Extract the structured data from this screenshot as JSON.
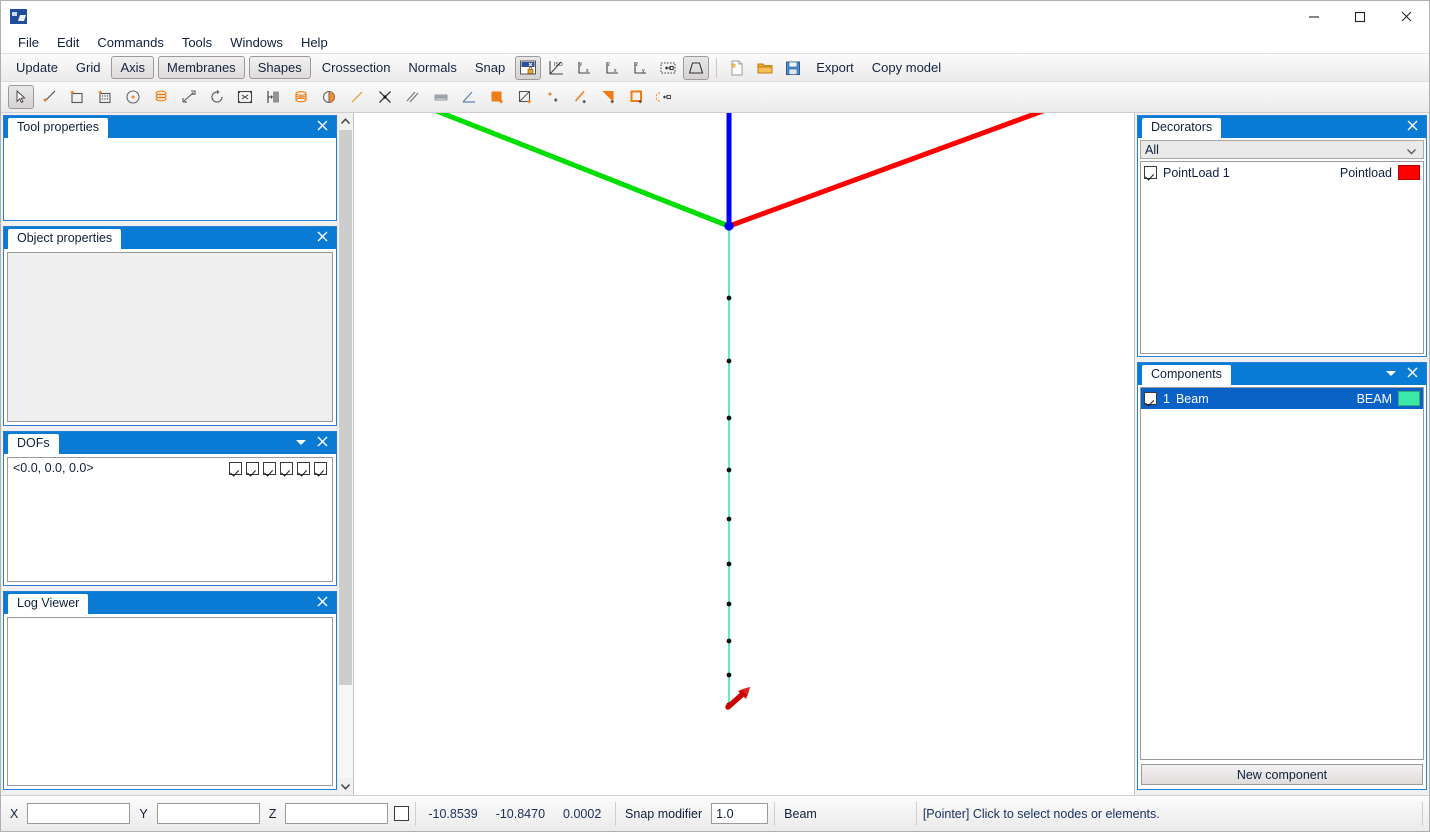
{
  "window": {
    "app_icon": "app-icon",
    "controls": {
      "minimize": "minimize",
      "maximize": "maximize",
      "close": "close"
    }
  },
  "menubar": {
    "items": [
      {
        "label": "File"
      },
      {
        "label": "Edit"
      },
      {
        "label": "Commands"
      },
      {
        "label": "Tools"
      },
      {
        "label": "Windows"
      },
      {
        "label": "Help"
      }
    ]
  },
  "toolbar_main": {
    "text_buttons": [
      {
        "label": "Update",
        "pressed": false
      },
      {
        "label": "Grid",
        "pressed": false
      },
      {
        "label": "Axis",
        "pressed": true
      },
      {
        "label": "Membranes",
        "pressed": true
      },
      {
        "label": "Shapes",
        "pressed": true
      },
      {
        "label": "Crossection",
        "pressed": false
      },
      {
        "label": "Normals",
        "pressed": false
      },
      {
        "label": "Snap",
        "pressed": false
      }
    ],
    "icon_buttons": [
      {
        "name": "lock-view-icon",
        "pressed": true
      },
      {
        "name": "iso-view-icon",
        "pressed": false
      },
      {
        "name": "yx-view-icon",
        "pressed": false
      },
      {
        "name": "zx-view-icon",
        "pressed": false
      },
      {
        "name": "zy-view-icon",
        "pressed": false
      },
      {
        "name": "zoom-extents-icon",
        "pressed": false
      },
      {
        "name": "perspective-icon",
        "pressed": true
      },
      {
        "name": "new-file-icon",
        "pressed": false
      },
      {
        "name": "open-folder-icon",
        "pressed": false
      },
      {
        "name": "save-disk-icon",
        "pressed": false
      }
    ],
    "export_label": "Export",
    "copy_model_label": "Copy model"
  },
  "toolbar_tools": {
    "icons": [
      {
        "name": "pointer-select-icon",
        "pressed": true
      },
      {
        "name": "add-line-icon",
        "pressed": false
      },
      {
        "name": "add-rectangle-icon",
        "pressed": false
      },
      {
        "name": "add-mesh-icon",
        "pressed": false
      },
      {
        "name": "add-circle-icon",
        "pressed": false
      },
      {
        "name": "extrude-stack-icon",
        "pressed": false
      },
      {
        "name": "move-icon",
        "pressed": false
      },
      {
        "name": "rotate-icon",
        "pressed": false
      },
      {
        "name": "scale-icon",
        "pressed": false
      },
      {
        "name": "mirror-icon",
        "pressed": false
      },
      {
        "name": "divide-cylinder-icon",
        "pressed": false
      },
      {
        "name": "split-circle-icon",
        "pressed": false
      },
      {
        "name": "line-tool-icon",
        "pressed": false
      },
      {
        "name": "intersect-icon",
        "pressed": false
      },
      {
        "name": "parallel-lines-icon",
        "pressed": false
      },
      {
        "name": "offset-icon",
        "pressed": false
      },
      {
        "name": "angle-icon",
        "pressed": false
      },
      {
        "name": "add-face-icon",
        "pressed": false
      },
      {
        "name": "add-surface-icon",
        "pressed": false
      },
      {
        "name": "add-point-icon",
        "pressed": false
      },
      {
        "name": "add-edge-icon",
        "pressed": false
      },
      {
        "name": "add-triangle-icon",
        "pressed": false
      },
      {
        "name": "add-quad-icon",
        "pressed": false
      },
      {
        "name": "add-load-icon",
        "pressed": false
      }
    ]
  },
  "left_dock": {
    "panels": [
      {
        "title": "Tool properties",
        "has_menu": false,
        "body": "empty-white"
      },
      {
        "title": "Object properties",
        "has_menu": false,
        "body": "empty-grey"
      },
      {
        "title": "DOFs",
        "has_menu": true,
        "body": "dofs"
      },
      {
        "title": "Log Viewer",
        "has_menu": false,
        "body": "empty-white"
      }
    ],
    "dofs": {
      "value": "<0.0, 0.0, 0.0>",
      "checkboxes": [
        true,
        true,
        true,
        true,
        true,
        true
      ]
    }
  },
  "right_dock": {
    "decorators": {
      "title": "Decorators",
      "filter_value": "All",
      "rows": [
        {
          "checked": true,
          "name": "PointLoad 1",
          "type": "Pointload",
          "color": "#ff0000"
        }
      ]
    },
    "components": {
      "title": "Components",
      "rows": [
        {
          "checked": true,
          "index": "1",
          "name": "Beam",
          "type": "BEAM",
          "color": "#3ce8a6",
          "selected": true
        }
      ],
      "new_button_label": "New component"
    }
  },
  "viewport": {
    "axes": [
      {
        "name": "x-axis",
        "color": "#ff0000"
      },
      {
        "name": "y-axis",
        "color": "#00dd00"
      },
      {
        "name": "z-axis",
        "color": "#0000ff"
      }
    ],
    "origin_node_color": "#0000ff",
    "beam_color": "#3ce8a6",
    "node_color": "#111111",
    "load_arrow_color": "#cc0000",
    "node_count": 11
  },
  "statusbar": {
    "x_label": "X",
    "y_label": "Y",
    "z_label": "Z",
    "x_value": "",
    "y_value": "",
    "z_value": "",
    "lock_checked": false,
    "coord_x": "-10.8539",
    "coord_y": "-10.8470",
    "coord_z": "0.0002",
    "snap_label": "Snap modifier",
    "snap_value": "1.0",
    "component_label": "Beam",
    "message": "[Pointer] Click to select nodes or elements."
  }
}
